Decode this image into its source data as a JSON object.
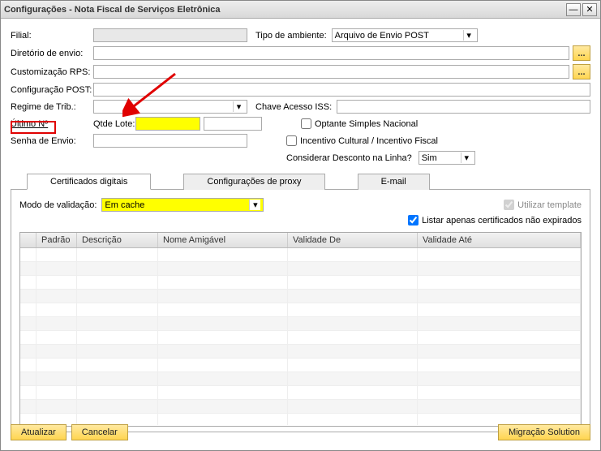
{
  "window": {
    "title": "Configurações - Nota Fiscal de Serviços Eletrônica"
  },
  "labels": {
    "filial": "Filial:",
    "tipoAmbiente": "Tipo de ambiente:",
    "diretorioEnvio": "Diretório de envio:",
    "customRPS": "Customização RPS:",
    "configPOST": "Configuração POST:",
    "regimeTrib": "Regime de Trib.:",
    "chaveISS": "Chave Acesso ISS:",
    "ultimoNo": "Último Nº",
    "qtdeLote": "Qtde Lote:",
    "senhaEnvio": "Senha de Envio:",
    "optanteSimples": "Optante Simples Nacional",
    "incentivo": "Incentivo Cultural / Incentivo Fiscal",
    "considerarDesconto": "Considerar Desconto na Linha?",
    "modoValidacao": "Modo de validação:",
    "utilizarTemplate": "Utilizar template",
    "listarNaoExpirados": "Listar apenas certificados não expirados"
  },
  "values": {
    "filial": "",
    "tipoAmbiente": "Arquivo de Envio POST",
    "diretorioEnvio": "",
    "customRPS": "",
    "configPOST": "",
    "regimeTrib": "",
    "chaveISS": "",
    "ultimoNo": "",
    "qtdeLote": "",
    "senhaEnvio": "",
    "considerarDesconto": "Sim",
    "modoValidacao": "Em cache"
  },
  "tabs": {
    "cert": "Certificados digitais",
    "proxy": "Configurações de proxy",
    "email": "E-mail"
  },
  "grid": {
    "headers": {
      "padrao": "Padrão",
      "descricao": "Descrição",
      "nomeAmigavel": "Nome Amigável",
      "validadeDe": "Validade De",
      "validadeAte": "Validade Até"
    }
  },
  "buttons": {
    "atualizar": "Atualizar",
    "cancelar": "Cancelar",
    "migracao": "Migração Solution",
    "browse": "..."
  },
  "icons": {
    "minimize": "—",
    "close": "✕",
    "dropdown": "▾"
  }
}
